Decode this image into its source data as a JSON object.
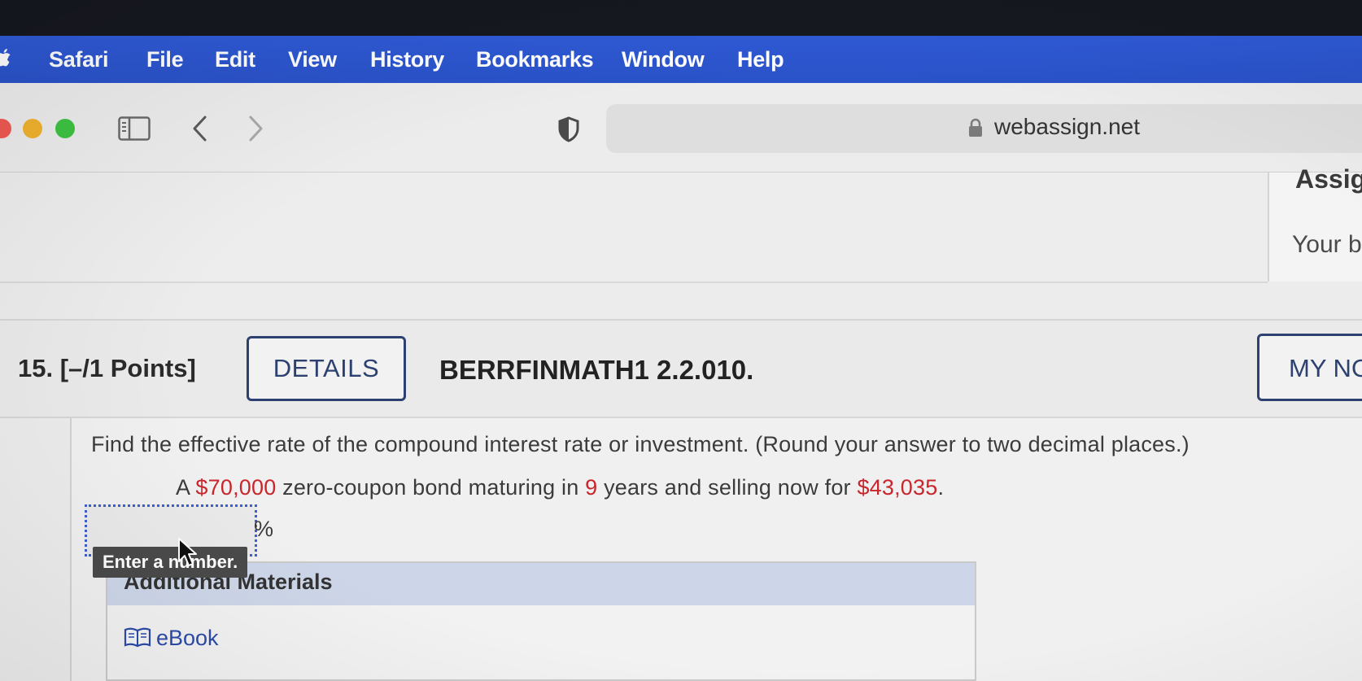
{
  "menubar": {
    "app": "Safari",
    "items": [
      "File",
      "Edit",
      "View",
      "History",
      "Bookmarks",
      "Window",
      "Help"
    ]
  },
  "toolbar": {
    "url": "webassign.net",
    "icons": [
      "sidebar-icon",
      "back-chevron-icon",
      "forward-chevron-icon",
      "shield-icon",
      "lock-icon"
    ]
  },
  "panel": {
    "title": "Assig",
    "subtitle": "Your b"
  },
  "question": {
    "number": "15.  [–/1 Points]",
    "details_label": "DETAILS",
    "code": "BERRFINMATH1 2.2.010.",
    "my_notes_label": "MY NO",
    "instruction": "Find the effective rate of the compound interest rate or investment. (Round your answer to two decimal places.)",
    "problem": {
      "prefix": "A ",
      "face_value": "$70,000",
      "mid1": " zero-coupon bond maturing in ",
      "years": "9",
      "mid2": " years and selling now for ",
      "price": "$43,035",
      "suffix": "."
    },
    "answer": {
      "value": "",
      "unit": "%"
    },
    "tooltip": "Enter a number."
  },
  "materials": {
    "title": "Additional Materials",
    "ebook_label": "eBook"
  },
  "colors": {
    "menubar": "#2f5ad6",
    "accent": "#2d4170",
    "highlight_red": "#c8262c",
    "link": "#2b4aa8",
    "materials_header": "#cdd6e8"
  }
}
